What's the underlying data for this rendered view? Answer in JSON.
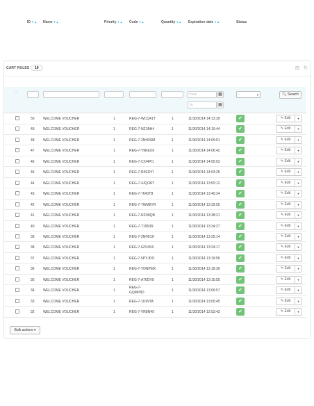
{
  "panel": {
    "title": "CART RULES",
    "count": "19"
  },
  "header_icons": {
    "add": "add-icon",
    "refresh": "refresh-icon"
  },
  "columns": {
    "id": "ID",
    "name": "Name",
    "priority": "Priority",
    "code": "Code",
    "quantity": "Quantity",
    "expiration": "Expiration date",
    "status": "Status"
  },
  "filters": {
    "dash": "--",
    "date_from_placeholder": "From",
    "date_to_placeholder": "To",
    "status_value": "-",
    "search_label": "Search"
  },
  "rows": [
    {
      "id": "50",
      "name": "WELCOME VOUCHER",
      "priority": "1",
      "code": "REG-7-WCQ41T",
      "quantity": "1",
      "expiration": "11/30/2014 14:13:39"
    },
    {
      "id": "49",
      "name": "WELCOME VOUCHER",
      "priority": "1",
      "code": "REG-7-NZ1BH4",
      "quantity": "1",
      "expiration": "11/30/2014 14:10:44"
    },
    {
      "id": "48",
      "name": "WELCOME VOUCHER",
      "priority": "1",
      "code": "REG-7-2NH3SM",
      "quantity": "1",
      "expiration": "11/30/2014 14:09:51"
    },
    {
      "id": "47",
      "name": "WELCOME VOUCHER",
      "priority": "1",
      "code": "REG-7-Y9KEO2",
      "quantity": "1",
      "expiration": "11/30/2014 14:06:42"
    },
    {
      "id": "46",
      "name": "WELCOME VOUCHER",
      "priority": "1",
      "code": "REG-7-CXI4PO",
      "quantity": "1",
      "expiration": "11/30/2014 14:05:03"
    },
    {
      "id": "45",
      "name": "WELCOME VOUCHER",
      "priority": "1",
      "code": "REG-7-R4EOYI",
      "quantity": "1",
      "expiration": "11/30/2014 14:03:25"
    },
    {
      "id": "44",
      "name": "WELCOME VOUCHER",
      "priority": "1",
      "code": "REG-7-4JQORT",
      "quantity": "1",
      "expiration": "11/30/2014 13:50:12"
    },
    {
      "id": "43",
      "name": "WELCOME VOUCHER",
      "priority": "1",
      "code": "REG-7-7643TB",
      "quantity": "1",
      "expiration": "11/30/2014 13:40:34"
    },
    {
      "id": "42",
      "name": "WELCOME VOUCHER",
      "priority": "1",
      "code": "REG-7-7WM6YR",
      "quantity": "1",
      "expiration": "11/30/2014 13:39:55"
    },
    {
      "id": "41",
      "name": "WELCOME VOUCHER",
      "priority": "1",
      "code": "REG-7-R2D8QB",
      "quantity": "1",
      "expiration": "11/30/2014 13:38:21"
    },
    {
      "id": "40",
      "name": "WELCOME VOUCHER",
      "priority": "1",
      "code": "REG-7-T1953R",
      "quantity": "1",
      "expiration": "11/30/2014 13:34:27"
    },
    {
      "id": "39",
      "name": "WELCOME VOUCHER",
      "priority": "1",
      "code": "REG-7-2NFB1H",
      "quantity": "1",
      "expiration": "11/30/2014 13:25:14"
    },
    {
      "id": "38",
      "name": "WELCOME VOUCHER",
      "priority": "1",
      "code": "REG-7-6ZV4SS",
      "quantity": "1",
      "expiration": "11/30/2014 13:24:17"
    },
    {
      "id": "37",
      "name": "WELCOME VOUCHER",
      "priority": "1",
      "code": "REG-7-5PYJDO",
      "quantity": "1",
      "expiration": "11/30/2014 13:19:56"
    },
    {
      "id": "36",
      "name": "WELCOME VOUCHER",
      "priority": "1",
      "code": "REG-7-YDNPMX",
      "quantity": "1",
      "expiration": "11/30/2014 13:18:30"
    },
    {
      "id": "35",
      "name": "WELCOME VOUCHER",
      "priority": "1",
      "code": "REG-7-A76DV9",
      "quantity": "1",
      "expiration": "11/30/2014 13:15:55"
    },
    {
      "id": "34",
      "name": "WELCOME VOUCHER",
      "priority": "1",
      "code": "REG-7-\nGQMP8D",
      "code_line1": "REG-7-",
      "code_line2": "GQMP8D",
      "quantity": "1",
      "expiration": "11/30/2014 13:06:57"
    },
    {
      "id": "33",
      "name": "WELCOME VOUCHER",
      "priority": "1",
      "code": "REG-7-1U99TA",
      "quantity": "1",
      "expiration": "11/30/2014 13:00:45"
    },
    {
      "id": "32",
      "name": "WELCOME VOUCHER",
      "priority": "1",
      "code": "REG-7-VR8N49",
      "quantity": "1",
      "expiration": "11/30/2014 12:53:43"
    }
  ],
  "row_action": {
    "edit_label": "Edit"
  },
  "bulk_actions_label": "Bulk actions",
  "colors": {
    "accent": "#25b9d7",
    "status_enabled": "#72c279",
    "filter_bg": "#eff8fb"
  }
}
